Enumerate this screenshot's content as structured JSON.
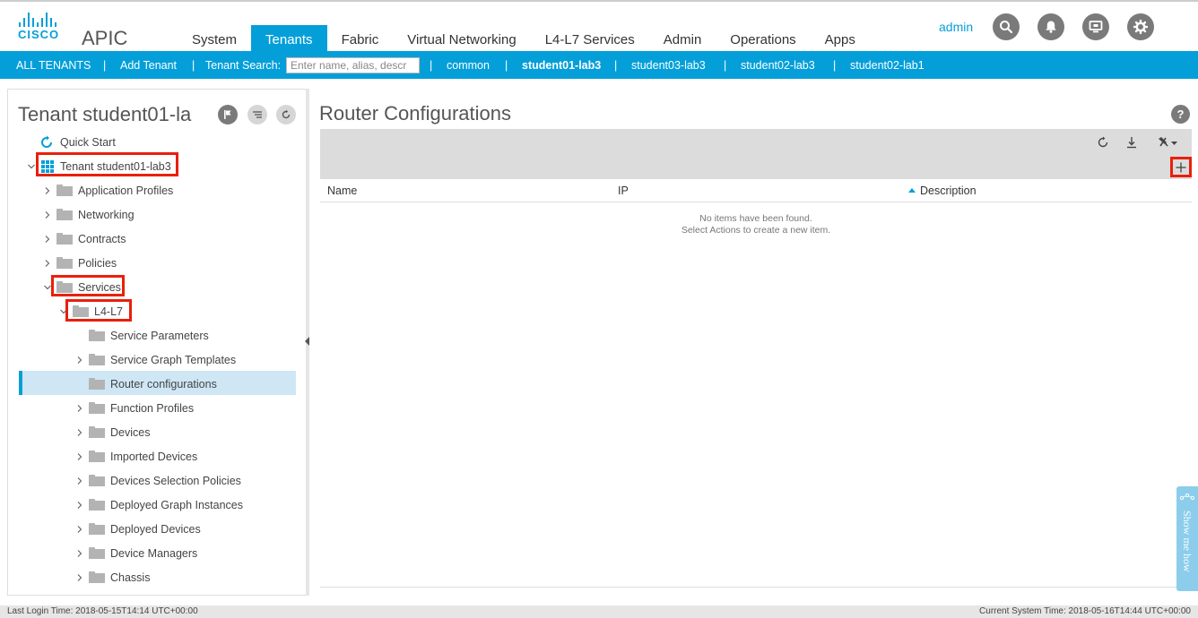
{
  "header": {
    "logo_text": "CISCO",
    "app_name": "APIC",
    "nav": [
      "System",
      "Tenants",
      "Fabric",
      "Virtual Networking",
      "L4-L7 Services",
      "Admin",
      "Operations",
      "Apps"
    ],
    "active_nav": "Tenants",
    "user": "admin",
    "icons": [
      "search-icon",
      "bell-icon",
      "monitor-icon",
      "gear-icon"
    ],
    "accent_color": "#049fd9"
  },
  "subnav": {
    "all_tenants": "ALL TENANTS",
    "add_tenant": "Add Tenant",
    "search_label": "Tenant Search:",
    "search_placeholder": "Enter name, alias, descr",
    "tenants": [
      "common",
      "student01-lab3",
      "student03-lab3",
      "student02-lab3",
      "student02-lab1"
    ],
    "current_tenant": "student01-lab3",
    "separator": "|"
  },
  "left": {
    "title": "Tenant student01-la",
    "tree": {
      "quick_start": "Quick Start",
      "tenant": "Tenant student01-lab3",
      "application_profiles": "Application Profiles",
      "networking": "Networking",
      "contracts": "Contracts",
      "policies": "Policies",
      "services": "Services",
      "l4l7": "L4-L7",
      "service_parameters": "Service Parameters",
      "service_graph_templates": "Service Graph Templates",
      "router_configurations": "Router configurations",
      "function_profiles": "Function Profiles",
      "devices": "Devices",
      "imported_devices": "Imported Devices",
      "devices_selection_policies": "Devices Selection Policies",
      "deployed_graph_instances": "Deployed Graph Instances",
      "deployed_devices": "Deployed Devices",
      "device_managers": "Device Managers",
      "chassis": "Chassis"
    },
    "selected": "Router configurations"
  },
  "right": {
    "title": "Router Configurations",
    "help": "?",
    "columns": [
      "Name",
      "IP",
      "Description"
    ],
    "sorted_column": "Description",
    "empty_line1": "No items have been found.",
    "empty_line2": "Select Actions to create a new item.",
    "show_me_how": "Show me how"
  },
  "footer": {
    "last_login": "Last Login Time: 2018-05-15T14:14 UTC+00:00",
    "current_time": "Current System Time: 2018-05-16T14:44 UTC+00:00"
  }
}
